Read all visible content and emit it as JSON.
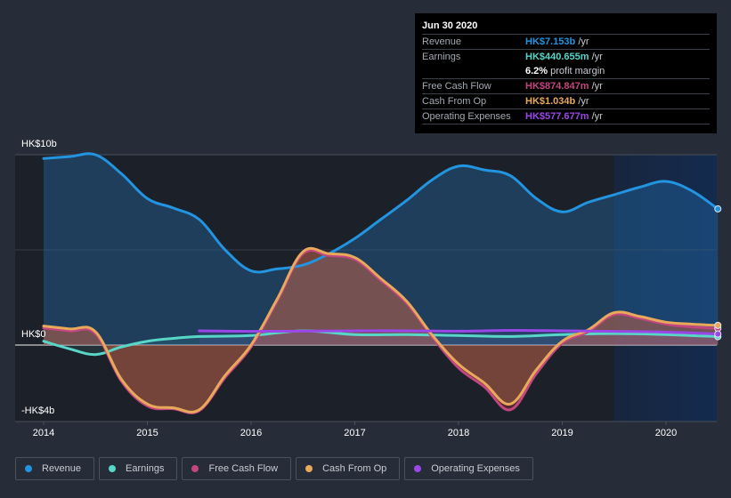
{
  "chart_data": {
    "type": "area",
    "title": "",
    "currency": "HK$",
    "xlabel": "",
    "ylabel": "",
    "ylim": [
      -4,
      10
    ],
    "xlim": [
      2013.9,
      2020.5
    ],
    "y_tick_labels": [
      "HK$10b",
      "HK$0",
      "-HK$4b"
    ],
    "y_ticks": [
      10,
      0,
      -4
    ],
    "x_ticks": [
      2014,
      2015,
      2016,
      2017,
      2018,
      2019,
      2020
    ],
    "x_tick_labels": [
      "2014",
      "2015",
      "2016",
      "2017",
      "2018",
      "2019",
      "2020"
    ],
    "highlight_range": [
      2019.5,
      2020.5
    ],
    "grid": true,
    "legend_position": "bottom",
    "series": [
      {
        "name": "Revenue",
        "color": "#2394df",
        "x": [
          2014.0,
          2014.25,
          2014.5,
          2014.75,
          2015.0,
          2015.25,
          2015.5,
          2015.75,
          2016.0,
          2016.25,
          2016.5,
          2016.75,
          2017.0,
          2017.25,
          2017.5,
          2017.75,
          2018.0,
          2018.25,
          2018.5,
          2018.75,
          2019.0,
          2019.25,
          2019.5,
          2019.75,
          2020.0,
          2020.25,
          2020.5
        ],
        "values": [
          9.8,
          9.9,
          10.0,
          9.0,
          7.7,
          7.2,
          6.6,
          5.0,
          3.9,
          4.0,
          4.2,
          4.8,
          5.6,
          6.6,
          7.6,
          8.7,
          9.4,
          9.2,
          8.9,
          7.7,
          7.0,
          7.5,
          7.9,
          8.3,
          8.6,
          8.1,
          7.153
        ]
      },
      {
        "name": "Earnings",
        "color": "#58d7c8",
        "x": [
          2014.0,
          2014.25,
          2014.5,
          2014.75,
          2015.0,
          2015.25,
          2015.5,
          2016.0,
          2016.5,
          2017.0,
          2017.5,
          2018.0,
          2018.5,
          2019.0,
          2019.5,
          2020.0,
          2020.5
        ],
        "values": [
          0.2,
          -0.2,
          -0.5,
          -0.1,
          0.2,
          0.35,
          0.45,
          0.5,
          0.75,
          0.55,
          0.55,
          0.5,
          0.45,
          0.55,
          0.6,
          0.55,
          0.441
        ]
      },
      {
        "name": "Free Cash Flow",
        "color": "#c2467f",
        "x": [
          2014.0,
          2014.25,
          2014.5,
          2014.75,
          2015.0,
          2015.25,
          2015.5,
          2015.75,
          2016.0,
          2016.25,
          2016.5,
          2016.75,
          2017.0,
          2017.25,
          2017.5,
          2017.75,
          2018.0,
          2018.25,
          2018.5,
          2018.75,
          2019.0,
          2019.25,
          2019.5,
          2019.75,
          2020.0,
          2020.25,
          2020.5
        ],
        "values": [
          0.9,
          0.75,
          0.6,
          -1.9,
          -3.2,
          -3.35,
          -3.45,
          -1.7,
          -0.1,
          2.3,
          4.8,
          4.7,
          4.5,
          3.4,
          2.2,
          0.4,
          -1.2,
          -2.2,
          -3.4,
          -1.5,
          0.1,
          0.7,
          1.6,
          1.4,
          1.1,
          0.95,
          0.875
        ]
      },
      {
        "name": "Cash From Op",
        "color": "#e8a95a",
        "x": [
          2014.0,
          2014.25,
          2014.5,
          2014.75,
          2015.0,
          2015.25,
          2015.5,
          2015.75,
          2016.0,
          2016.25,
          2016.5,
          2016.75,
          2017.0,
          2017.25,
          2017.5,
          2017.75,
          2018.0,
          2018.25,
          2018.5,
          2018.75,
          2019.0,
          2019.25,
          2019.5,
          2019.75,
          2020.0,
          2020.25,
          2020.5
        ],
        "values": [
          1.0,
          0.85,
          0.7,
          -1.8,
          -3.1,
          -3.3,
          -3.4,
          -1.6,
          0.0,
          2.4,
          4.9,
          4.8,
          4.6,
          3.5,
          2.3,
          0.5,
          -1.0,
          -2.0,
          -3.1,
          -1.3,
          0.2,
          0.8,
          1.7,
          1.5,
          1.2,
          1.1,
          1.034
        ]
      },
      {
        "name": "Operating Expenses",
        "color": "#9b47e8",
        "x": [
          2015.5,
          2016.0,
          2016.5,
          2017.0,
          2017.5,
          2018.0,
          2018.5,
          2019.0,
          2019.5,
          2020.0,
          2020.5
        ],
        "values": [
          0.75,
          0.72,
          0.73,
          0.75,
          0.75,
          0.73,
          0.77,
          0.75,
          0.72,
          0.68,
          0.578
        ]
      }
    ]
  },
  "tooltip": {
    "date": "Jun 30 2020",
    "rows": [
      {
        "label": "Revenue",
        "value": "HK$7.153b",
        "unit": " /yr",
        "color": "#2394df"
      },
      {
        "label": "Earnings",
        "value": "HK$440.655m",
        "unit": " /yr",
        "color": "#58d7c8"
      },
      {
        "label": "",
        "value": "6.2%",
        "unit": " profit margin",
        "color": "#ffffff"
      },
      {
        "label": "Free Cash Flow",
        "value": "HK$874.847m",
        "unit": " /yr",
        "color": "#c2467f"
      },
      {
        "label": "Cash From Op",
        "value": "HK$1.034b",
        "unit": " /yr",
        "color": "#e8a95a"
      },
      {
        "label": "Operating Expenses",
        "value": "HK$577.677m",
        "unit": " /yr",
        "color": "#9b47e8"
      }
    ]
  },
  "legend": [
    {
      "label": "Revenue",
      "color": "#2394df"
    },
    {
      "label": "Earnings",
      "color": "#58d7c8"
    },
    {
      "label": "Free Cash Flow",
      "color": "#c2467f"
    },
    {
      "label": "Cash From Op",
      "color": "#e8a95a"
    },
    {
      "label": "Operating Expenses",
      "color": "#9b47e8"
    }
  ]
}
